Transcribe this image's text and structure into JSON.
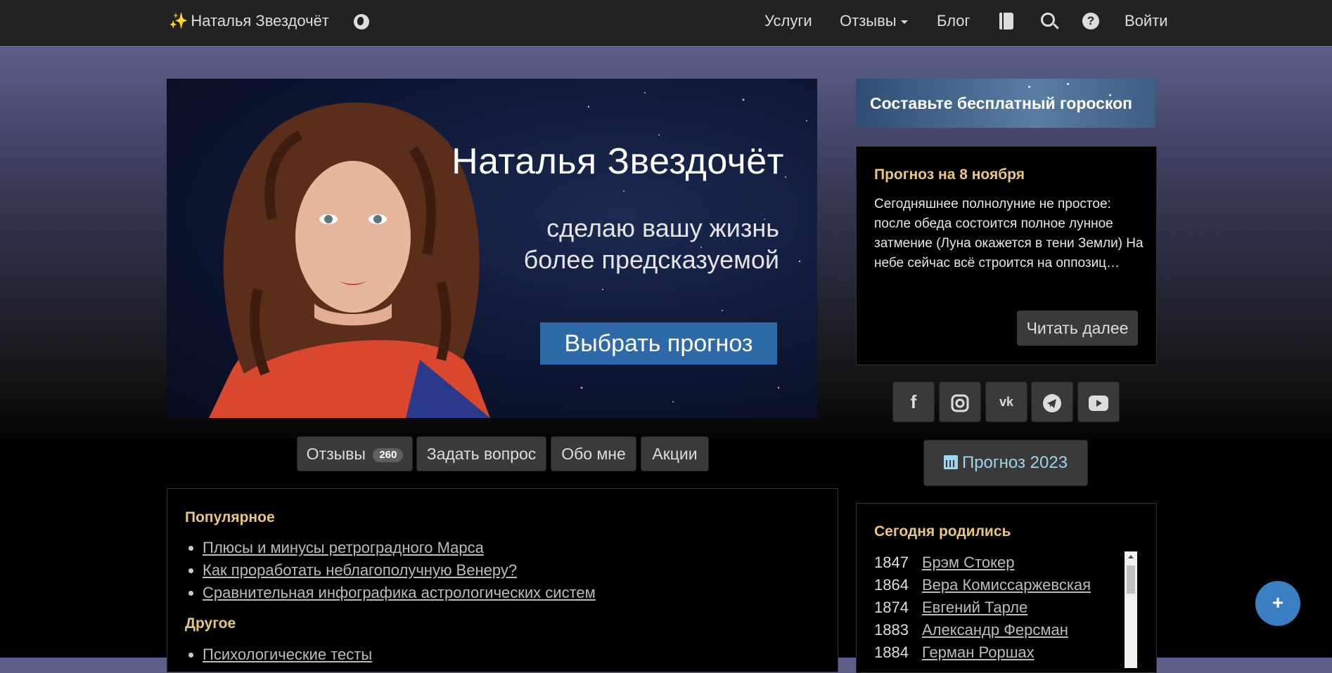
{
  "nav": {
    "brand": "Наталья Звездочёт",
    "items": [
      "Услуги",
      "Отзывы",
      "Блог"
    ],
    "login": "Войти"
  },
  "banner": {
    "title": "Наталья Звездочёт",
    "subtitle_line1": "сделаю вашу жизнь",
    "subtitle_line2": "более предсказуемой",
    "button": "Выбрать прогноз"
  },
  "tabs": {
    "reviews": "Отзывы",
    "reviews_count": "260",
    "ask": "Задать вопрос",
    "about": "Обо мне",
    "promo": "Акции"
  },
  "popular": {
    "heading": "Популярное",
    "items": [
      "Плюсы и минусы ретроградного Марса",
      "Как проработать неблагополучную Венеру?",
      "Сравнительная инфографика астрологических систем"
    ],
    "other_heading": "Другое",
    "other_items": [
      "Психологические тесты"
    ]
  },
  "sidebar": {
    "horoscope_button": "Составьте бесплатный гороскоп",
    "forecast_heading": "Прогноз на 8 ноября",
    "forecast_text": "Сегодняшнее полнолуние не простое: после обеда состоится полное лунное затмение (Луна окажется в тени Земли) На небе сейчас всё строится на оппозиц…",
    "read_more": "Читать далее",
    "social_icons": [
      "facebook-icon",
      "instagram-icon",
      "vk-icon",
      "telegram-icon",
      "youtube-icon"
    ],
    "forecast_year_button": "Прогноз 2023",
    "born_heading": "Сегодня родились",
    "births": [
      {
        "year": "1847",
        "name": "Брэм Стокер"
      },
      {
        "year": "1864",
        "name": "Вера Комиссаржевская"
      },
      {
        "year": "1874",
        "name": "Евгений Тарле"
      },
      {
        "year": "1883",
        "name": "Александр Ферсман"
      },
      {
        "year": "1884",
        "name": "Герман Роршах"
      }
    ]
  },
  "fab": "+",
  "colors": {
    "accent_heading": "#e8c77d",
    "button_blue": "#2e6aa8",
    "fab_blue": "#3a7fc4",
    "navbar": "#222222"
  }
}
